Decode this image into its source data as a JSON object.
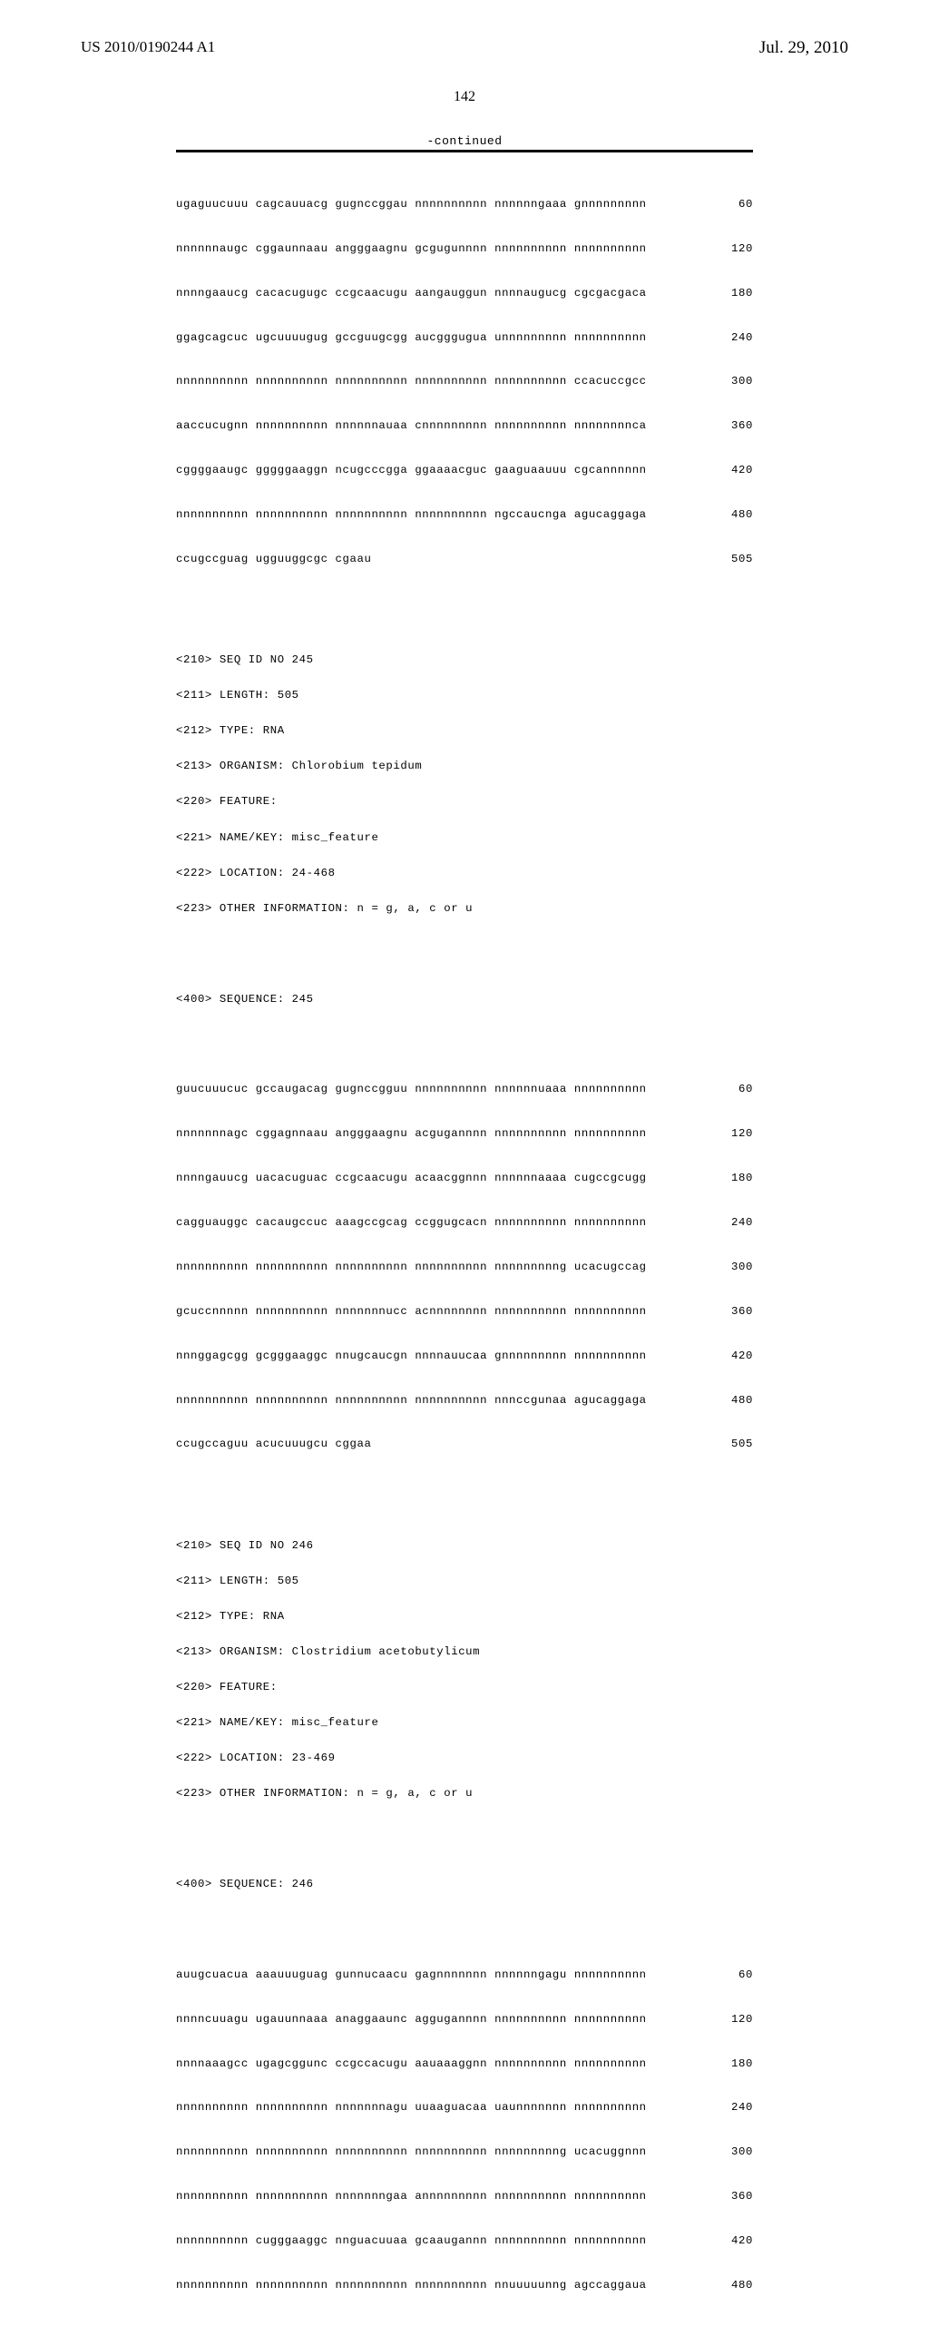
{
  "header": {
    "publication_number": "US 2010/0190244 A1",
    "publication_date": "Jul. 29, 2010",
    "page_number": "142",
    "continued_label": "-continued"
  },
  "block1": {
    "rows": [
      {
        "seq": "ugaguucuuu cagcauuacg gugnccggau nnnnnnnnnn nnnnnngaaa gnnnnnnnnn",
        "num": "60"
      },
      {
        "seq": "nnnnnnaugc cggaunnaau angggaagnu gcgugunnnn nnnnnnnnnn nnnnnnnnnn",
        "num": "120"
      },
      {
        "seq": "nnnngaaucg cacacugugc ccgcaacugu aangauggun nnnnaugucg cgcgacgaca",
        "num": "180"
      },
      {
        "seq": "ggagcagcuc ugcuuuugug gccguugcgg aucgggugua unnnnnnnnn nnnnnnnnnn",
        "num": "240"
      },
      {
        "seq": "nnnnnnnnnn nnnnnnnnnn nnnnnnnnnn nnnnnnnnnn nnnnnnnnnn ccacuccgcc",
        "num": "300"
      },
      {
        "seq": "aaccucugnn nnnnnnnnnn nnnnnnauaa cnnnnnnnnn nnnnnnnnnn nnnnnnnnca",
        "num": "360"
      },
      {
        "seq": "cggggaaugc gggggaaggn ncugcccgga ggaaaacguc gaaguaauuu cgcannnnnn",
        "num": "420"
      },
      {
        "seq": "nnnnnnnnnn nnnnnnnnnn nnnnnnnnnn nnnnnnnnnn ngccaucnga agucaggaga",
        "num": "480"
      },
      {
        "seq": "ccugccguag ugguuggcgc cgaau",
        "num": "505"
      }
    ]
  },
  "meta245": [
    "<210> SEQ ID NO 245",
    "<211> LENGTH: 505",
    "<212> TYPE: RNA",
    "<213> ORGANISM: Chlorobium tepidum",
    "<220> FEATURE:",
    "<221> NAME/KEY: misc_feature",
    "<222> LOCATION: 24-468",
    "<223> OTHER INFORMATION: n = g, a, c or u"
  ],
  "seq245_label": "<400> SEQUENCE: 245",
  "block245": {
    "rows": [
      {
        "seq": "guucuuucuc gccaugacag gugnccgguu nnnnnnnnnn nnnnnnuaaa nnnnnnnnnn",
        "num": "60"
      },
      {
        "seq": "nnnnnnnagc cggagnnaau angggaagnu acgugannnn nnnnnnnnnn nnnnnnnnnn",
        "num": "120"
      },
      {
        "seq": "nnnngauucg uacacuguac ccgcaacugu acaacggnnn nnnnnnaaaa cugccgcugg",
        "num": "180"
      },
      {
        "seq": "cagguauggc cacaugccuc aaagccgcag ccggugcacn nnnnnnnnnn nnnnnnnnnn",
        "num": "240"
      },
      {
        "seq": "nnnnnnnnnn nnnnnnnnnn nnnnnnnnnn nnnnnnnnnn nnnnnnnnng ucacugccag",
        "num": "300"
      },
      {
        "seq": "gcuccnnnnn nnnnnnnnnn nnnnnnnucc acnnnnnnnn nnnnnnnnnn nnnnnnnnnn",
        "num": "360"
      },
      {
        "seq": "nnnggagcgg gcgggaaggc nnugcaucgn nnnnauucaa gnnnnnnnnn nnnnnnnnnn",
        "num": "420"
      },
      {
        "seq": "nnnnnnnnnn nnnnnnnnnn nnnnnnnnnn nnnnnnnnnn nnnccgunaa agucaggaga",
        "num": "480"
      },
      {
        "seq": "ccugccaguu acucuuugcu cggaa",
        "num": "505"
      }
    ]
  },
  "meta246": [
    "<210> SEQ ID NO 246",
    "<211> LENGTH: 505",
    "<212> TYPE: RNA",
    "<213> ORGANISM: Clostridium acetobutylicum",
    "<220> FEATURE:",
    "<221> NAME/KEY: misc_feature",
    "<222> LOCATION: 23-469",
    "<223> OTHER INFORMATION: n = g, a, c or u"
  ],
  "seq246_label": "<400> SEQUENCE: 246",
  "block246": {
    "rows": [
      {
        "seq": "auugcuacua aaauuuguag gunnucaacu gagnnnnnnn nnnnnngagu nnnnnnnnnn",
        "num": "60"
      },
      {
        "seq": "nnnncuuagu ugauunnaaa anaggaaunc aggugannnn nnnnnnnnnn nnnnnnnnnn",
        "num": "120"
      },
      {
        "seq": "nnnnaaagcc ugagcggunc ccgccacugu aauaaaggnn nnnnnnnnnn nnnnnnnnnn",
        "num": "180"
      },
      {
        "seq": "nnnnnnnnnn nnnnnnnnnn nnnnnnnagu uuaaguacaa uaunnnnnnn nnnnnnnnnn",
        "num": "240"
      },
      {
        "seq": "nnnnnnnnnn nnnnnnnnnn nnnnnnnnnn nnnnnnnnnn nnnnnnnnng ucacuggnnn",
        "num": "300"
      },
      {
        "seq": "nnnnnnnnnn nnnnnnnnnn nnnnnnngaa annnnnnnnn nnnnnnnnnn nnnnnnnnnn",
        "num": "360"
      },
      {
        "seq": "nnnnnnnnnn cugggaaggc nnguacuuaa gcaaugannn nnnnnnnnnn nnnnnnnnnn",
        "num": "420"
      },
      {
        "seq": "nnnnnnnnnn nnnnnnnnnn nnnnnnnnnn nnnnnnnnnn nnuuuuunng agccaggaua",
        "num": "480"
      }
    ]
  }
}
